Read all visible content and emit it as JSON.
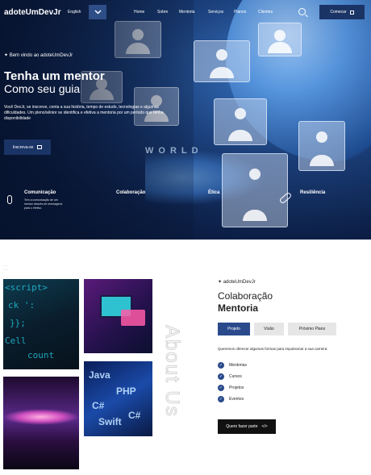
{
  "nav": {
    "logo": "adoteUmDevJr",
    "language": "English",
    "links": [
      "Home",
      "Sobre",
      "Mentoria",
      "Serviços",
      "Planos",
      "Clientes"
    ],
    "login_label": "Comecar"
  },
  "hero": {
    "welcome": "Bem vindo ao adoteUmDevJr",
    "title": "Tenha um mentor",
    "subtitle": "Como seu guia",
    "description": "Você DevJr, se inscreve, conta a sua história, tempo de estudo, tecnologias e algumas dificuldades. Um pleno/sênior se identifica e efetiva a mentoria por um período que tenha disponibilidade",
    "cta_label": "Inscreva-se",
    "background_text": "WORLD",
    "features": [
      {
        "title": "Comunicação",
        "desc": "Tem a comunicação de um mentor através de mensagens para o efetivo."
      },
      {
        "title": "Colaboração",
        "desc": ""
      },
      {
        "title": "Ética",
        "desc": ""
      },
      {
        "title": "Resiliência",
        "desc": ""
      }
    ]
  },
  "about": {
    "vertical_text": "About Us",
    "brand": "adoteUmDevJr",
    "title": "Colaboração",
    "subtitle": "Mentoria",
    "tabs": [
      "Projeto",
      "Visão",
      "Próximo Plano"
    ],
    "intro": "Queremos oferecer algumas formas para impulsionar a sua carreira:",
    "items": [
      "Mentorias",
      "Cursos",
      "Projetos",
      "Eventos"
    ],
    "cta_label": "Quero fazer parte"
  },
  "colors": {
    "accent": "#2a4a8c",
    "dark": "#111111"
  }
}
